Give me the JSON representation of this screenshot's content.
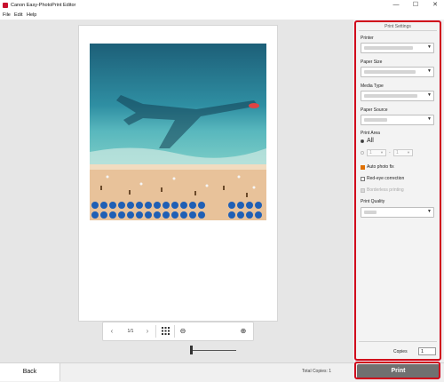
{
  "window": {
    "title": "Canon Easy-PhotoPrint Editor",
    "minimize": "—",
    "maximize": "☐",
    "close": "✕"
  },
  "menu": [
    "File",
    "Edit",
    "Help"
  ],
  "toolbar": {
    "prev": "‹",
    "page": "1/1",
    "next": "›",
    "zoom_out": "⊖",
    "zoom_in": "⊕",
    "zoom_level": 0.0
  },
  "footer": {
    "back_label": "Back",
    "total_copies_label": "Total Copies: 1",
    "print_label": "Print"
  },
  "panel": {
    "title": "Print Settings",
    "printer_label": "Printer",
    "paper_size_label": "Paper Size",
    "media_type_label": "Media Type",
    "paper_source_label": "Paper Source",
    "print_area_label": "Print Area",
    "all_label": "All",
    "range_from": "1",
    "range_dash": "-",
    "range_to": "1",
    "auto_photo_fix_label": "Auto photo fix",
    "red_eye_label": "Red-eye correction",
    "borderless_label": "Borderless printing",
    "print_quality_label": "Print Quality",
    "copies_label": "Copies",
    "copies_value": "1"
  },
  "colors": {
    "highlight": "#d0021b",
    "checkbox_on": "#e07000",
    "print_button": "#707070"
  }
}
